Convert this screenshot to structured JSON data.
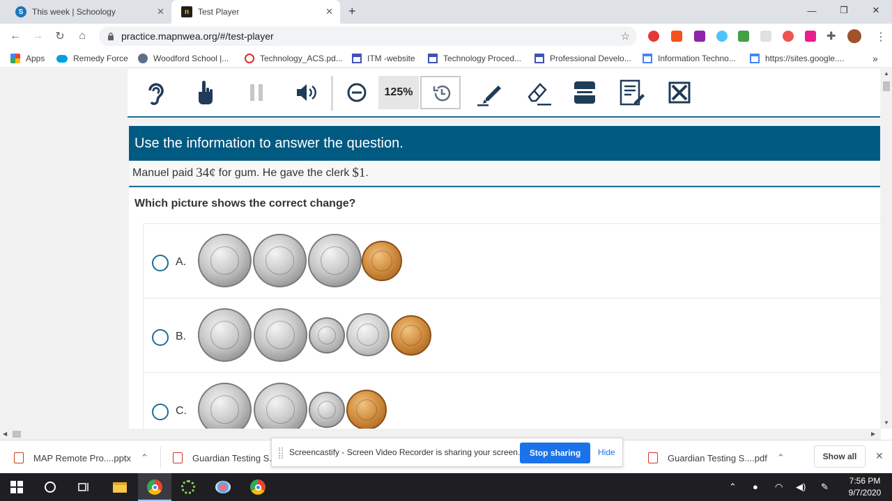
{
  "browser": {
    "tabs": [
      {
        "title": "This week | Schoology",
        "icon": "schoology-icon"
      },
      {
        "title": "Test Player",
        "icon": "nwea-icon"
      }
    ],
    "new_tab": "+",
    "url": "practice.mapnwea.org/#/test-player",
    "bookmarks": [
      "Apps",
      "Remedy Force",
      "Woodford School |...",
      "Technology_ACS.pd...",
      "ITM -website",
      "Technology Proced...",
      "Professional Develo...",
      "Information Techno...",
      "https://sites.google...."
    ],
    "bookmarks_overflow": "»"
  },
  "player": {
    "toolbar": {
      "tools": [
        "listen-icon",
        "answer-eliminator-icon",
        "pause-icon",
        "volume-icon",
        "zoom-out-icon",
        "zoom-reset-icon",
        "highlighter-icon",
        "eraser-icon",
        "line-reader-icon",
        "notepad-icon",
        "answer-masking-icon"
      ],
      "zoom_level": "125%"
    },
    "instruction": "Use the information to answer the question.",
    "stem": {
      "part1": "Manuel paid",
      "amount1": "34¢",
      "part2": "for gum. He gave the clerk",
      "amount2": "$1",
      "part3": "."
    },
    "question": "Which picture shows the correct change?",
    "options": [
      {
        "label": "A.",
        "coins": [
          "quarter",
          "quarter",
          "quarter",
          "penny"
        ]
      },
      {
        "label": "B.",
        "coins": [
          "quarter",
          "quarter",
          "dime",
          "nickel",
          "penny"
        ]
      },
      {
        "label": "C.",
        "coins": [
          "quarter",
          "quarter",
          "dime",
          "penny"
        ]
      }
    ]
  },
  "downloads": {
    "items": [
      "MAP Remote Pro....pptx",
      "Guardian Testing S...",
      "Guardian Testing S....pdf"
    ],
    "show_all": "Show all",
    "share_text": "Screencastify - Screen Video Recorder is sharing your screen.",
    "stop_sharing": "Stop sharing",
    "hide": "Hide"
  },
  "taskbar": {
    "time": "7:56 PM",
    "date": "9/7/2020"
  },
  "colors": {
    "accent": "#005a82",
    "accent_line": "#1b6e93",
    "chrome_blue": "#1a73e8"
  }
}
